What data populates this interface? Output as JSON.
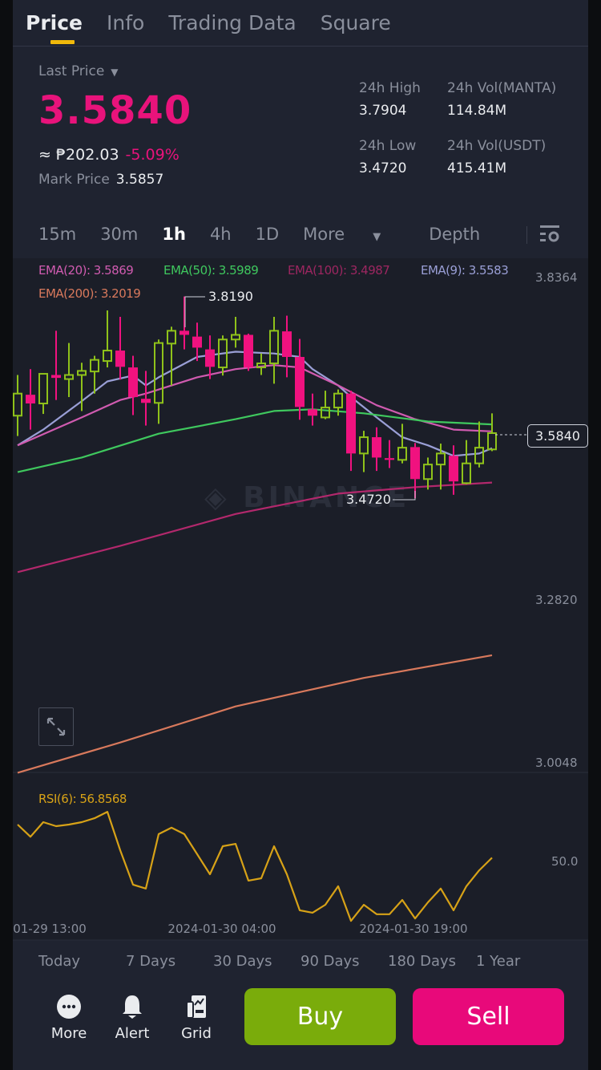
{
  "tabs": [
    "Price",
    "Info",
    "Trading Data",
    "Square"
  ],
  "active_tab": "Price",
  "ticker": {
    "last_price_label": "Last Price",
    "last_price": "3.5840",
    "fiat_value": "≈ ₱202.03",
    "change_pct": "-5.09%",
    "mark_price_label": "Mark Price",
    "mark_price": "3.5857",
    "high_label": "24h High",
    "high": "3.7904",
    "low_label": "24h Low",
    "low": "3.4720",
    "vol_base_label": "24h Vol(MANTA)",
    "vol_base": "114.84M",
    "vol_quote_label": "24h Vol(USDT)",
    "vol_quote": "415.41M"
  },
  "intervals": [
    "15m",
    "30m",
    "1h",
    "4h",
    "1D",
    "More",
    "Depth"
  ],
  "active_interval": "1h",
  "colors": {
    "up": "#8fc21a",
    "down": "#f0127f",
    "accent": "#f0b90b",
    "buy": "#7aac0b",
    "sell": "#e8097a"
  },
  "legend": {
    "ema20": "EMA(20): 3.5869",
    "ema50": "EMA(50): 3.5989",
    "ema100": "EMA(100): 3.4987",
    "ema9": "EMA(9): 3.5583",
    "ema200": "EMA(200): 3.2019",
    "rsi": "RSI(6): 56.8568"
  },
  "watermark": "BINANCE",
  "chart_data": {
    "type": "candlestick",
    "price_axis_ticks": [
      "3.8364",
      "3.2820",
      "3.0048"
    ],
    "current_price_label": "3.5840",
    "high_annotation": "3.8190",
    "low_annotation": "3.4720",
    "time_labels": [
      "01-29 13:00",
      "2024-01-30 04:00",
      "2024-01-30 19:00"
    ],
    "candles_ohlc": [
      [
        3.614,
        3.684,
        3.579,
        3.652
      ],
      [
        3.65,
        3.694,
        3.59,
        3.635
      ],
      [
        3.635,
        3.686,
        3.617,
        3.686
      ],
      [
        3.684,
        3.76,
        3.641,
        3.679
      ],
      [
        3.677,
        3.739,
        3.646,
        3.684
      ],
      [
        3.684,
        3.705,
        3.622,
        3.691
      ],
      [
        3.69,
        3.717,
        3.652,
        3.71
      ],
      [
        3.708,
        3.795,
        3.697,
        3.726
      ],
      [
        3.726,
        3.784,
        3.676,
        3.698
      ],
      [
        3.697,
        3.717,
        3.615,
        3.646
      ],
      [
        3.643,
        3.691,
        3.597,
        3.636
      ],
      [
        3.636,
        3.745,
        3.6,
        3.739
      ],
      [
        3.738,
        3.767,
        3.666,
        3.76
      ],
      [
        3.76,
        3.819,
        3.728,
        3.753
      ],
      [
        3.75,
        3.774,
        3.708,
        3.731
      ],
      [
        3.728,
        3.752,
        3.677,
        3.698
      ],
      [
        3.697,
        3.752,
        3.683,
        3.745
      ],
      [
        3.745,
        3.784,
        3.731,
        3.753
      ],
      [
        3.753,
        3.755,
        3.691,
        3.697
      ],
      [
        3.697,
        3.721,
        3.684,
        3.704
      ],
      [
        3.704,
        3.784,
        3.669,
        3.76
      ],
      [
        3.759,
        3.786,
        3.68,
        3.715
      ],
      [
        3.715,
        3.746,
        3.607,
        3.629
      ],
      [
        3.625,
        3.652,
        3.597,
        3.614
      ],
      [
        3.611,
        3.657,
        3.608,
        3.628
      ],
      [
        3.628,
        3.659,
        3.614,
        3.652
      ],
      [
        3.652,
        3.657,
        3.519,
        3.549
      ],
      [
        3.549,
        3.588,
        3.517,
        3.577
      ],
      [
        3.577,
        3.594,
        3.519,
        3.542
      ],
      [
        3.541,
        3.572,
        3.524,
        3.538
      ],
      [
        3.538,
        3.6,
        3.532,
        3.559
      ],
      [
        3.56,
        3.567,
        3.472,
        3.505
      ],
      [
        3.505,
        3.542,
        3.487,
        3.53
      ],
      [
        3.53,
        3.566,
        3.487,
        3.549
      ],
      [
        3.545,
        3.563,
        3.478,
        3.501
      ],
      [
        3.498,
        3.572,
        3.496,
        3.532
      ],
      [
        3.532,
        3.604,
        3.525,
        3.559
      ],
      [
        3.556,
        3.618,
        3.553,
        3.584
      ]
    ],
    "ema_series": [
      {
        "name": "EMA(9)",
        "color": "#9a9fd6",
        "points": [
          [
            0,
            3.563
          ],
          [
            2,
            3.59
          ],
          [
            5,
            3.639
          ],
          [
            7,
            3.673
          ],
          [
            9,
            3.683
          ],
          [
            10,
            3.666
          ],
          [
            11,
            3.68
          ],
          [
            14,
            3.715
          ],
          [
            17,
            3.724
          ],
          [
            20,
            3.721
          ],
          [
            22,
            3.715
          ],
          [
            23,
            3.694
          ],
          [
            25,
            3.666
          ],
          [
            26,
            3.646
          ],
          [
            28,
            3.611
          ],
          [
            30,
            3.577
          ],
          [
            32,
            3.563
          ],
          [
            34,
            3.545
          ],
          [
            36,
            3.549
          ],
          [
            37,
            3.558
          ]
        ]
      },
      {
        "name": "EMA(20)",
        "color": "#d05bb0",
        "points": [
          [
            0,
            3.563
          ],
          [
            5,
            3.611
          ],
          [
            8,
            3.641
          ],
          [
            10,
            3.652
          ],
          [
            14,
            3.68
          ],
          [
            17,
            3.694
          ],
          [
            20,
            3.701
          ],
          [
            22,
            3.697
          ],
          [
            25,
            3.666
          ],
          [
            28,
            3.632
          ],
          [
            31,
            3.608
          ],
          [
            34,
            3.59
          ],
          [
            37,
            3.587
          ]
        ]
      },
      {
        "name": "EMA(50)",
        "color": "#3fc85e",
        "points": [
          [
            0,
            3.517
          ],
          [
            5,
            3.542
          ],
          [
            11,
            3.583
          ],
          [
            17,
            3.608
          ],
          [
            20,
            3.622
          ],
          [
            23,
            3.625
          ],
          [
            27,
            3.618
          ],
          [
            32,
            3.604
          ],
          [
            37,
            3.599
          ]
        ]
      },
      {
        "name": "EMA(100)",
        "color": "#b2286c",
        "points": [
          [
            0,
            3.345
          ],
          [
            8,
            3.39
          ],
          [
            17,
            3.445
          ],
          [
            25,
            3.48
          ],
          [
            31,
            3.491
          ],
          [
            37,
            3.499
          ]
        ]
      },
      {
        "name": "EMA(200)",
        "color": "#d8795c",
        "points": [
          [
            0,
            3.0
          ],
          [
            8,
            3.052
          ],
          [
            17,
            3.114
          ],
          [
            27,
            3.163
          ],
          [
            37,
            3.202
          ]
        ]
      }
    ],
    "rsi": {
      "label": "RSI(6)",
      "tick": "50.0",
      "color": "#d7a217",
      "values": [
        69.4,
        64.8,
        70.3,
        68.8,
        69.4,
        70.3,
        71.8,
        74.2,
        59.7,
        46.7,
        45.2,
        65.8,
        68.2,
        65.8,
        58.2,
        50.6,
        61.2,
        62.1,
        48.2,
        49.1,
        61.2,
        50.6,
        37.0,
        36.1,
        39.1,
        46.1,
        33.0,
        39.1,
        35.5,
        35.5,
        40.9,
        33.9,
        40.0,
        45.2,
        37.0,
        46.1,
        52.1,
        56.86
      ]
    }
  },
  "ranges": [
    "Today",
    "7 Days",
    "30 Days",
    "90 Days",
    "180 Days",
    "1 Year"
  ],
  "bottom": {
    "more": "More",
    "alert": "Alert",
    "grid": "Grid",
    "buy": "Buy",
    "sell": "Sell"
  }
}
